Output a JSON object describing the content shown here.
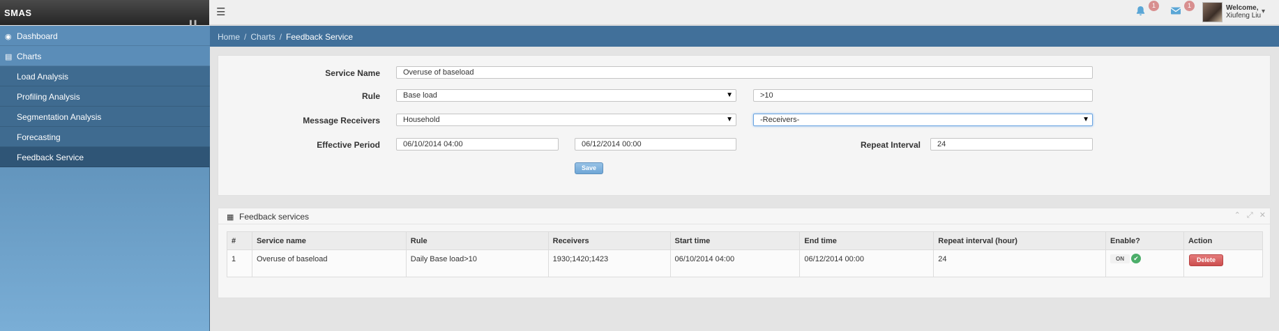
{
  "app": {
    "brand": "SMAS"
  },
  "topbar": {
    "notifications_count": "1",
    "messages_count": "1",
    "welcome": "Welcome,",
    "user_name": "Xiufeng Liu"
  },
  "sidebar": {
    "items": [
      {
        "label": "Dashboard",
        "icon": "dashboard-icon"
      },
      {
        "label": "Charts",
        "icon": "bar-chart-icon"
      }
    ],
    "sub_items": [
      {
        "label": "Load Analysis"
      },
      {
        "label": "Profiling Analysis"
      },
      {
        "label": "Segmentation Analysis"
      },
      {
        "label": "Forecasting"
      },
      {
        "label": "Feedback Service",
        "active": true
      }
    ]
  },
  "breadcrumb": {
    "home": "Home",
    "charts": "Charts",
    "current": "Feedback Service"
  },
  "form": {
    "service_name_label": "Service Name",
    "service_name_value": "Overuse of baseload",
    "rule_label": "Rule",
    "rule_select": "Base load",
    "rule_value": ">10",
    "receivers_label": "Message Receivers",
    "receivers_select": "Household",
    "receivers_list_select": "-Receivers-",
    "period_label": "Effective Period",
    "period_start": "06/10/2014 04:00",
    "period_end": "06/12/2014 00:00",
    "repeat_label": "Repeat Interval",
    "repeat_value": "24",
    "save_label": "Save"
  },
  "table_panel": {
    "title": "Feedback services",
    "headers": [
      "#",
      "Service name",
      "Rule",
      "Receivers",
      "Start time",
      "End time",
      "Repeat interval (hour)",
      "Enable?",
      "Action"
    ],
    "rows": [
      {
        "num": "1",
        "service_name": "Overuse of baseload",
        "rule": "Daily Base load>10",
        "receivers": "1930;1420;1423",
        "start": "06/10/2014 04:00",
        "end": "06/12/2014 00:00",
        "repeat": "24",
        "enabled": "ON",
        "action": "Delete"
      }
    ]
  },
  "colors": {
    "sidebar": "#5b8db8",
    "breadcrumb": "#41709a",
    "accent": "#6ea6d6",
    "delete": "#cc4e4e",
    "enabled": "#4cae6a"
  }
}
